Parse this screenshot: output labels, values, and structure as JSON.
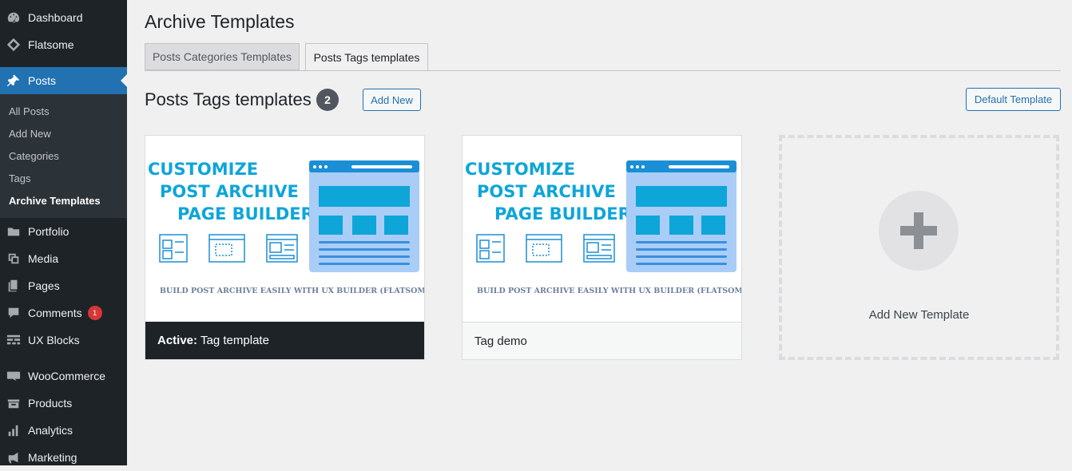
{
  "sidebar": {
    "items": [
      {
        "label": "Dashboard",
        "icon": "dashboard-icon"
      },
      {
        "label": "Flatsome",
        "icon": "flatsome-icon"
      },
      {
        "label": "Posts",
        "icon": "pin-icon",
        "active": true
      },
      {
        "label": "Portfolio",
        "icon": "folder-icon"
      },
      {
        "label": "Media",
        "icon": "media-icon"
      },
      {
        "label": "Pages",
        "icon": "pages-icon"
      },
      {
        "label": "Comments",
        "icon": "comment-icon",
        "badge": "1"
      },
      {
        "label": "UX Blocks",
        "icon": "blocks-icon"
      },
      {
        "label": "WooCommerce",
        "icon": "woo-icon"
      },
      {
        "label": "Products",
        "icon": "products-icon"
      },
      {
        "label": "Analytics",
        "icon": "analytics-icon"
      },
      {
        "label": "Marketing",
        "icon": "megaphone-icon"
      }
    ],
    "submenu": [
      "All Posts",
      "Add New",
      "Categories",
      "Tags",
      "Archive Templates"
    ]
  },
  "page": {
    "title": "Archive Templates",
    "tabs": [
      "Posts Categories Templates",
      "Posts Tags templates"
    ],
    "active_tab": "Posts Tags templates",
    "section_title": "Posts Tags templates",
    "count": "2",
    "add_new_label": "Add New",
    "default_template_label": "Default Template"
  },
  "thumbnail": {
    "line1": "CUSTOMIZE",
    "line2": "POST ARCHIVE",
    "line3": "PAGE BUILDER",
    "subtitle": "BUILD POST ARCHIVE EASILY WITH UX BUILDER (FLATSOME)"
  },
  "cards": [
    {
      "active_prefix": "Active:",
      "name": "Tag template"
    },
    {
      "name": "Tag demo"
    }
  ],
  "add_template_label": "Add New Template",
  "colors": {
    "sidebar": "#1d2327",
    "accent": "#2271b1",
    "thumb_blue": "#0ea5d9",
    "badge_red": "#d63638"
  }
}
